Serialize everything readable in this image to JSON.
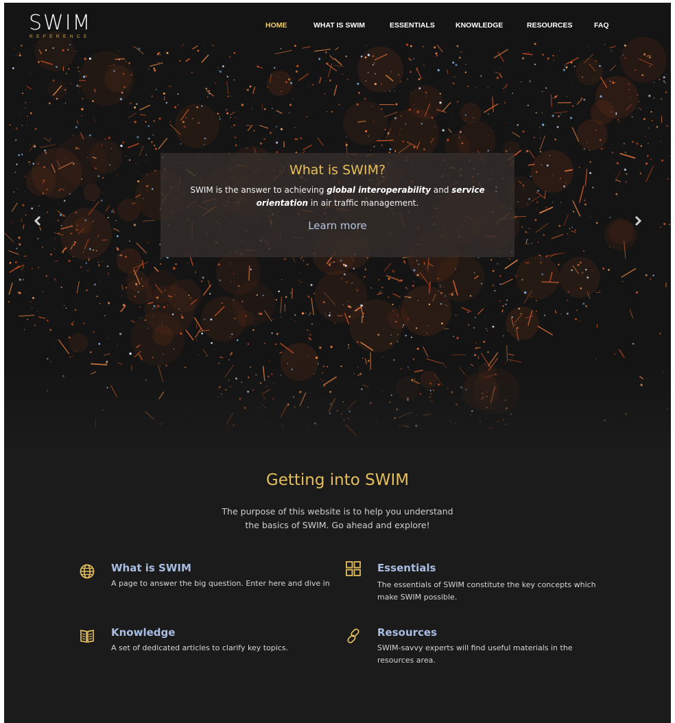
{
  "brand": {
    "name": "SWIM",
    "tagline": "REFERENCE"
  },
  "nav": {
    "items": [
      {
        "label": "HOME",
        "active": true
      },
      {
        "label": "WHAT IS SWIM",
        "active": false
      },
      {
        "label": "ESSENTIALS",
        "active": false
      },
      {
        "label": "KNOWLEDGE",
        "active": false
      },
      {
        "label": "RESOURCES",
        "active": false
      },
      {
        "label": "FAQ",
        "active": false
      }
    ]
  },
  "hero": {
    "title": "What is SWIM?",
    "text_before": "SWIM is the answer to achieving ",
    "emph_1": "global interoperability",
    "text_middle": " and ",
    "emph_2": "service orientation",
    "text_after": " in air traffic management.",
    "cta": "Learn more",
    "prev_icon": "chevron-left-icon",
    "next_icon": "chevron-right-icon"
  },
  "intro": {
    "title": "Getting into SWIM",
    "text": "The purpose of this website is to help you understand the basics of SWIM. Go ahead and explore!"
  },
  "features": [
    {
      "icon": "globe-icon",
      "title": "What is SWIM",
      "description": "A page to answer the big question. Enter here and dive in"
    },
    {
      "icon": "grid-icon",
      "title": "Essentials",
      "description": "The essentials of SWIM constitute the key concepts which make SWIM possible."
    },
    {
      "icon": "book-icon",
      "title": "Knowledge",
      "description": "A set of dedicated articles to clarify key topics."
    },
    {
      "icon": "link-icon",
      "title": "Resources",
      "description": "SWIM-savvy experts will find useful materials in the resources area."
    }
  ],
  "colors": {
    "accent": "#e4bf5c",
    "nav_active": "#f1d06a",
    "link": "#a9bde3",
    "background": "#1b1b1b"
  }
}
